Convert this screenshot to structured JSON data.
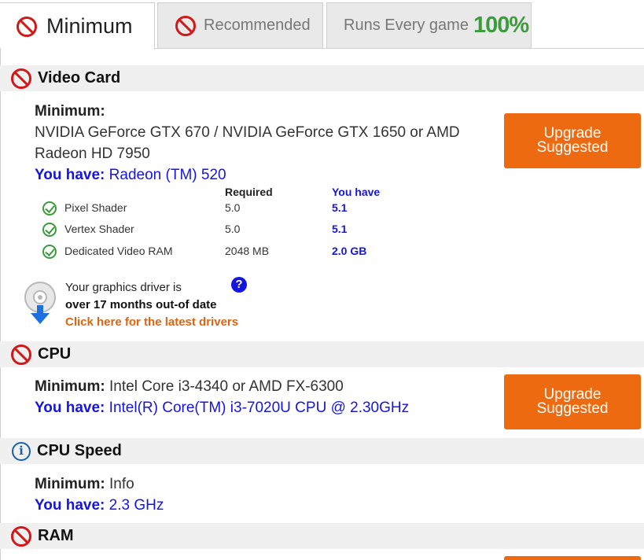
{
  "tabs": {
    "minimum": "Minimum",
    "recommended": "Recommended",
    "runs_label": "Runs Every game",
    "runs_percent": "100%"
  },
  "video_card": {
    "title": "Video Card",
    "min_label": "Minimum:",
    "min_value_line1": "NVIDIA GeForce GTX 670 / NVIDIA GeForce GTX 1650 or AMD",
    "min_value_line2": "Radeon HD 7950",
    "have_label": "You have:",
    "have_value": "Radeon (TM) 520",
    "button": {
      "line1": "Upgrade",
      "line2": "Suggested"
    },
    "table": {
      "col_required": "Required",
      "col_have": "You have",
      "rows": [
        {
          "name": "Pixel Shader",
          "required": "5.0",
          "have": "5.1"
        },
        {
          "name": "Vertex Shader",
          "required": "5.0",
          "have": "5.1"
        },
        {
          "name": "Dedicated Video RAM",
          "required": "2048 MB",
          "have": "2.0 GB"
        }
      ]
    },
    "driver": {
      "line1": "Your graphics driver is",
      "line2": "over 17 months out-of date",
      "link": "Click here for the latest drivers",
      "help": "?"
    }
  },
  "cpu": {
    "title": "CPU",
    "min_label": "Minimum:",
    "min_value": "Intel Core i3-4340 or AMD FX-6300",
    "have_label": "You have:",
    "have_value": "Intel(R) Core(TM) i3-7020U CPU @ 2.30GHz",
    "button": {
      "line1": "Upgrade",
      "line2": "Suggested"
    }
  },
  "cpu_speed": {
    "title": "CPU Speed",
    "icon_glyph": "i",
    "min_label": "Minimum:",
    "min_value": "Info",
    "have_label": "You have:",
    "have_value": "2.3 GHz"
  },
  "ram": {
    "title": "RAM"
  },
  "colors": {
    "accent_orange": "#ee6a10",
    "fail_red": "#d31818",
    "pass_green": "#3a9c3a",
    "have_blue": "#1515e0",
    "runs_green": "#3a9c3a"
  }
}
